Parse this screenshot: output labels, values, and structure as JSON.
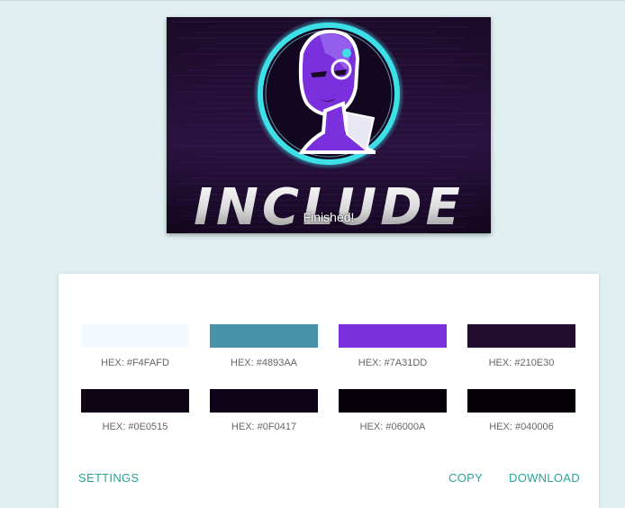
{
  "preview": {
    "logo_text": "INCLUDE",
    "status": "Finished!"
  },
  "palette": {
    "swatches": [
      {
        "color": "#F4FAFD",
        "label": "HEX: #F4FAFD"
      },
      {
        "color": "#4893AA",
        "label": "HEX: #4893AA"
      },
      {
        "color": "#7A31DD",
        "label": "HEX: #7A31DD"
      },
      {
        "color": "#210E30",
        "label": "HEX: #210E30"
      },
      {
        "color": "#0E0515",
        "label": "HEX: #0E0515"
      },
      {
        "color": "#0F0417",
        "label": "HEX: #0F0417"
      },
      {
        "color": "#06000A",
        "label": "HEX: #06000A"
      },
      {
        "color": "#040006",
        "label": "HEX: #040006"
      }
    ]
  },
  "actions": {
    "settings": "SETTINGS",
    "copy": "COPY",
    "download": "DOWNLOAD"
  },
  "colors": {
    "accent": "#26a69a",
    "background": "#e0f0f0",
    "ring": "#3ee0e8"
  }
}
